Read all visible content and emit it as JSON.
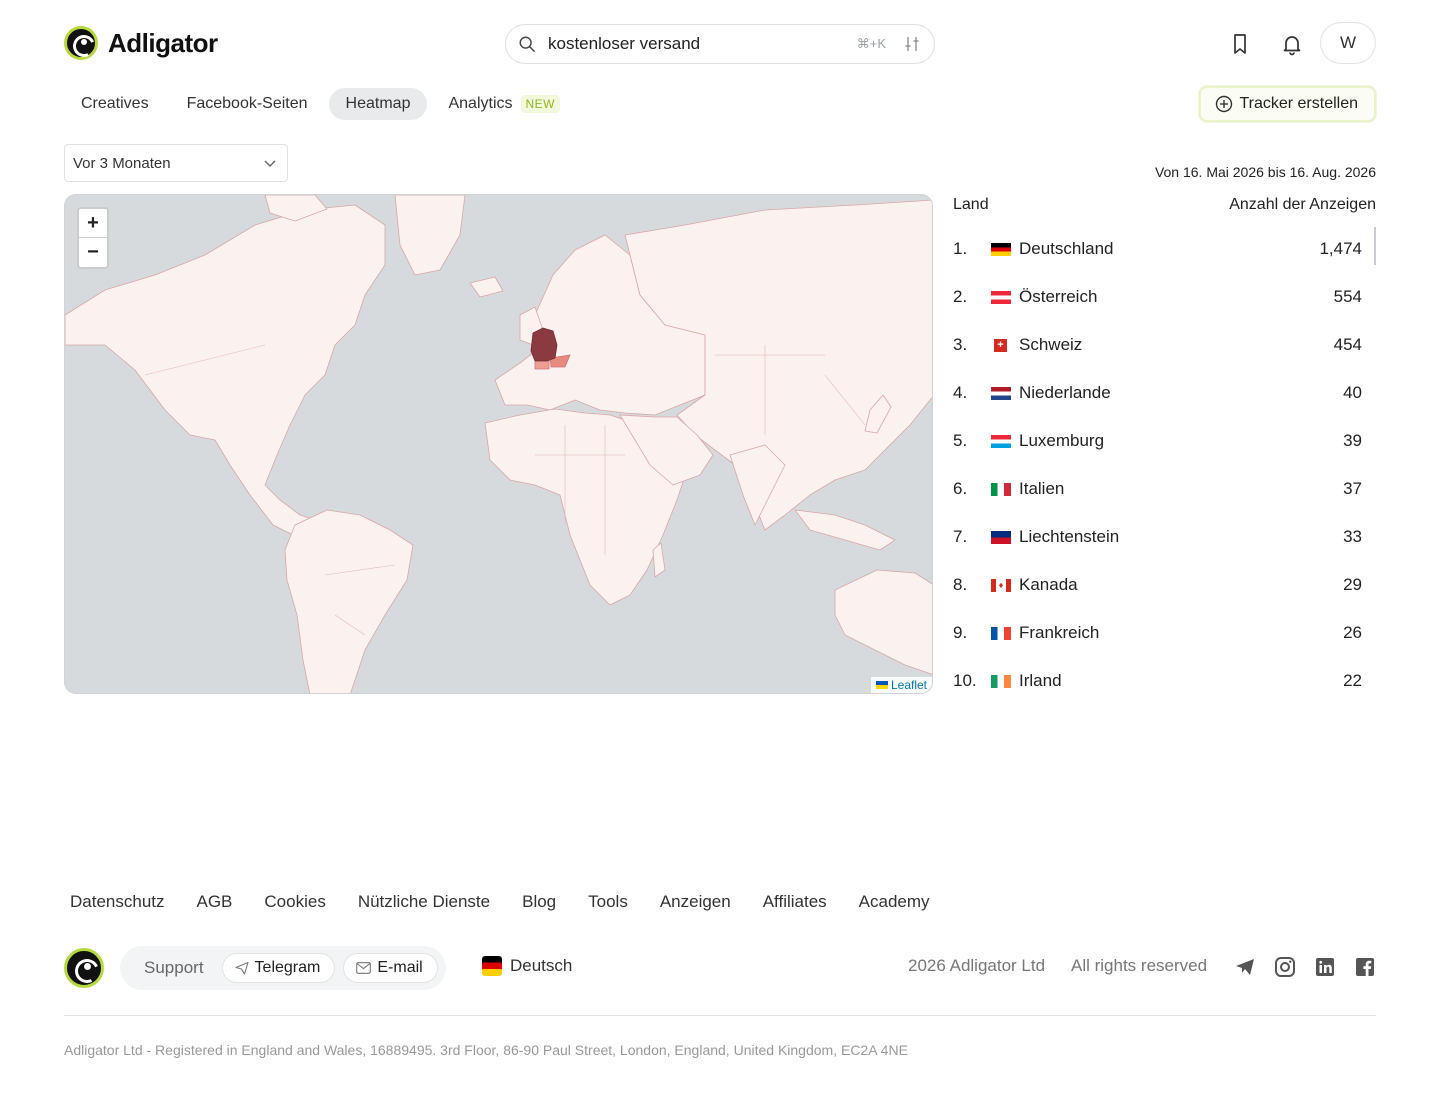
{
  "app": {
    "name": "Adligator"
  },
  "header": {
    "search_value": "kostenloser versand",
    "search_shortcut": "⌘+K",
    "avatar_initial": "W"
  },
  "tabs": [
    {
      "label": "Creatives"
    },
    {
      "label": "Facebook-Seiten"
    },
    {
      "label": "Heatmap",
      "active": true
    },
    {
      "label": "Analytics",
      "badge": "NEW"
    }
  ],
  "tracker_button": "Tracker erstellen",
  "period": {
    "selected": "Vor 3 Monaten"
  },
  "map": {
    "zoom_in": "+",
    "zoom_out": "−",
    "attribution": "Leaflet"
  },
  "countries": {
    "date_range": "Von 16. Mai 2026 bis 16. Aug. 2026",
    "col_country": "Land",
    "col_count": "Anzahl der Anzeigen",
    "rows": [
      {
        "rank": "1.",
        "name": "Deutschland",
        "count": "1,474",
        "flag": "de"
      },
      {
        "rank": "2.",
        "name": "Österreich",
        "count": "554",
        "flag": "at"
      },
      {
        "rank": "3.",
        "name": "Schweiz",
        "count": "454",
        "flag": "ch"
      },
      {
        "rank": "4.",
        "name": "Niederlande",
        "count": "40",
        "flag": "nl"
      },
      {
        "rank": "5.",
        "name": "Luxemburg",
        "count": "39",
        "flag": "lu"
      },
      {
        "rank": "6.",
        "name": "Italien",
        "count": "37",
        "flag": "it"
      },
      {
        "rank": "7.",
        "name": "Liechtenstein",
        "count": "33",
        "flag": "li"
      },
      {
        "rank": "8.",
        "name": "Kanada",
        "count": "29",
        "flag": "ca"
      },
      {
        "rank": "9.",
        "name": "Frankreich",
        "count": "26",
        "flag": "fr"
      },
      {
        "rank": "10.",
        "name": "Irland",
        "count": "22",
        "flag": "ie"
      }
    ]
  },
  "footer": {
    "links": [
      "Datenschutz",
      "AGB",
      "Cookies",
      "Nützliche Dienste",
      "Blog",
      "Tools",
      "Anzeigen",
      "Affiliates",
      "Academy"
    ],
    "support_label": "Support",
    "telegram": "Telegram",
    "email": "E-mail",
    "language": "Deutsch",
    "copyright": "2026 Adligator Ltd",
    "rights": "All rights reserved",
    "legal": "Adligator Ltd - Registered in England and Wales, 16889495. 3rd Floor, 86-90 Paul Street, London, England, United Kingdom, EC2A 4NE"
  },
  "colors": {
    "accent_lime": "#b6d940",
    "heat_max": "#8b3a3f",
    "heat_mid": "#e88a80",
    "land": "#fbf1ef",
    "water": "#d7dadc"
  }
}
